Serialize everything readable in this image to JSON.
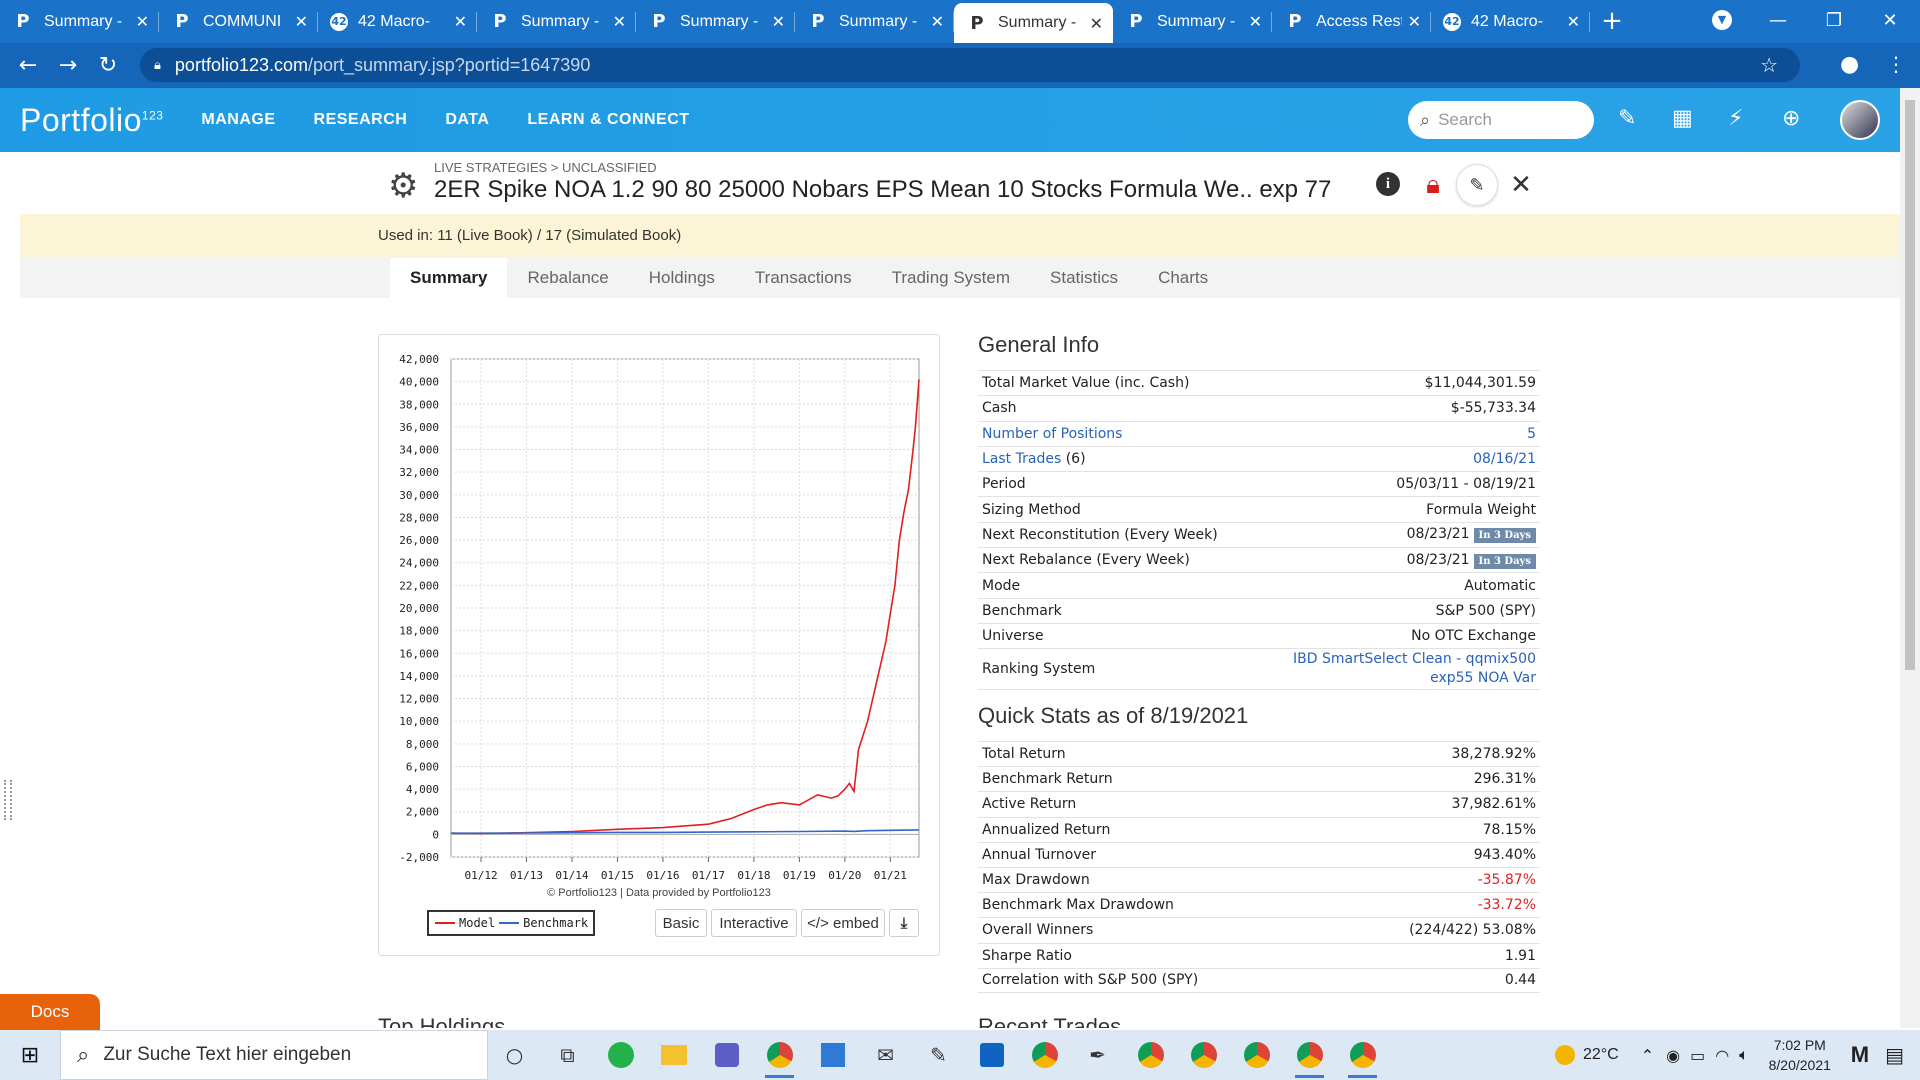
{
  "browser": {
    "tabs": [
      {
        "label": "Summary -",
        "icon": "P",
        "active": false
      },
      {
        "label": "COMMUNI",
        "icon": "P",
        "active": false
      },
      {
        "label": "42 Macro-",
        "icon": "42",
        "active": false
      },
      {
        "label": "Summary -",
        "icon": "P",
        "active": false
      },
      {
        "label": "Summary -",
        "icon": "P",
        "active": false
      },
      {
        "label": "Summary -",
        "icon": "P",
        "active": false
      },
      {
        "label": "Summary -",
        "icon": "P",
        "active": true
      },
      {
        "label": "Summary -",
        "icon": "P",
        "active": false
      },
      {
        "label": "Access Rest",
        "icon": "P",
        "active": false
      },
      {
        "label": "42 Macro-",
        "icon": "42",
        "active": false
      }
    ],
    "url_domain": "portfolio123.com",
    "url_path": "/port_summary.jsp?portid=1647390"
  },
  "site": {
    "logo": "Portfolio",
    "logo_sup": "123",
    "nav": [
      "MANAGE",
      "RESEARCH",
      "DATA",
      "LEARN & CONNECT"
    ],
    "search_placeholder": "Search"
  },
  "strategy": {
    "breadcrumb": "LIVE STRATEGIES > UNCLASSIFIED",
    "title": "2ER Spike NOA 1.2 90 80 25000 Nobars EPS Mean 10 Stocks Formula We.. exp 77",
    "used_in": "Used in: 11 (Live Book) / 17 (Simulated Book)"
  },
  "subtabs": [
    "Summary",
    "Rebalance",
    "Holdings",
    "Transactions",
    "Trading System",
    "Statistics",
    "Charts"
  ],
  "chart": {
    "copyright": "© Portfolio123 | Data provided by Portfolio123",
    "legend": [
      "Model",
      "Benchmark"
    ],
    "buttons": [
      "Basic",
      "Interactive",
      "</> embed"
    ]
  },
  "chart_data": {
    "type": "line",
    "title": "",
    "xlabel": "",
    "ylabel": "",
    "ylim": [
      -2000,
      42000
    ],
    "yticks": [
      42000,
      40000,
      38000,
      36000,
      34000,
      32000,
      30000,
      28000,
      26000,
      24000,
      22000,
      20000,
      18000,
      16000,
      14000,
      12000,
      10000,
      8000,
      6000,
      4000,
      2000,
      0,
      -2000
    ],
    "ytick_labels": [
      "42,000",
      "40,000",
      "38,000",
      "36,000",
      "34,000",
      "32,000",
      "30,000",
      "28,000",
      "26,000",
      "24,000",
      "22,000",
      "20,000",
      "18,000",
      "16,000",
      "14,000",
      "12,000",
      "10,000",
      "8,000",
      "6,000",
      "4,000",
      "2,000",
      "0",
      "-2,000"
    ],
    "xticks": [
      "01/12",
      "01/13",
      "01/14",
      "01/15",
      "01/16",
      "01/17",
      "01/18",
      "01/19",
      "01/20",
      "01/21"
    ],
    "xlim": [
      2011.34,
      2021.63
    ],
    "grid": true,
    "legend_position": "bottom-left",
    "series": [
      {
        "name": "Model",
        "color": "#e02020",
        "x": [
          2011.34,
          2012.0,
          2013.0,
          2014.0,
          2015.0,
          2016.0,
          2017.0,
          2017.5,
          2018.0,
          2018.3,
          2018.6,
          2019.0,
          2019.4,
          2019.7,
          2019.85,
          2020.0,
          2020.1,
          2020.2,
          2020.3,
          2020.5,
          2020.7,
          2020.9,
          2021.0,
          2021.1,
          2021.2,
          2021.3,
          2021.4,
          2021.5,
          2021.55,
          2021.6,
          2021.63
        ],
        "y": [
          100,
          80,
          150,
          250,
          450,
          600,
          900,
          1400,
          2200,
          2600,
          2800,
          2600,
          3500,
          3200,
          3400,
          4000,
          4500,
          3800,
          7500,
          10000,
          13500,
          17000,
          19500,
          22000,
          26000,
          28500,
          30500,
          34000,
          36000,
          38500,
          40200
        ]
      },
      {
        "name": "Benchmark",
        "color": "#3366cc",
        "x": [
          2011.34,
          2012.0,
          2013.0,
          2014.0,
          2015.0,
          2016.0,
          2017.0,
          2018.0,
          2019.0,
          2020.0,
          2020.2,
          2020.5,
          2021.0,
          2021.63
        ],
        "y": [
          100,
          105,
          120,
          150,
          170,
          175,
          200,
          230,
          250,
          290,
          260,
          320,
          360,
          396
        ]
      }
    ]
  },
  "general_info": {
    "title": "General Info",
    "rows": [
      {
        "label": "Total Market Value (inc. Cash)",
        "value": "$11,044,301.59"
      },
      {
        "label": "Cash",
        "value": "$-55,733.34"
      },
      {
        "label": "Number of Positions",
        "value": "5",
        "link": true
      },
      {
        "label": "Last Trades",
        "label_suffix": " (6)",
        "value": "08/16/21",
        "link": true
      },
      {
        "label": "Period",
        "value": "05/03/11 - 08/19/21"
      },
      {
        "label": "Sizing Method",
        "value": "Formula Weight"
      },
      {
        "label": "Next Reconstitution (Every Week)",
        "value": "08/23/21",
        "badge": "In 3 Days"
      },
      {
        "label": "Next Rebalance (Every Week)",
        "value": "08/23/21",
        "badge": "In 3 Days"
      },
      {
        "label": "Mode",
        "value": "Automatic"
      },
      {
        "label": "Benchmark",
        "value": "S&P 500 (SPY)"
      },
      {
        "label": "Universe",
        "value": "No OTC Exchange"
      }
    ],
    "ranking_label": "Ranking System",
    "ranking_value_1": "IBD SmartSelect Clean - qqmix500",
    "ranking_value_2": "exp55 NOA Var"
  },
  "quick_stats": {
    "title": "Quick Stats as of 8/19/2021",
    "rows": [
      {
        "label": "Total Return",
        "value": "38,278.92%"
      },
      {
        "label": "Benchmark Return",
        "value": "296.31%"
      },
      {
        "label": "Active Return",
        "value": "37,982.61%"
      },
      {
        "label": "Annualized Return",
        "value": "78.15%"
      },
      {
        "label": "Annual Turnover",
        "value": "943.40%"
      },
      {
        "label": "Max Drawdown",
        "value": "-35.87%",
        "negative": true
      },
      {
        "label": "Benchmark Max Drawdown",
        "value": "-33.72%",
        "negative": true
      },
      {
        "label": "Overall Winners",
        "value": "(224/422) 53.08%"
      },
      {
        "label": "Sharpe Ratio",
        "value": "1.91"
      },
      {
        "label": "Correlation with S&P 500 (SPY)",
        "value": "0.44"
      }
    ]
  },
  "lower_sections": {
    "left": "Top Holdings",
    "right": "Recent Trades"
  },
  "docs_label": "Docs",
  "taskbar": {
    "search_placeholder": "Zur Suche Text hier eingeben",
    "weather": "22°C",
    "time": "7:02 PM",
    "date": "8/20/2021"
  }
}
